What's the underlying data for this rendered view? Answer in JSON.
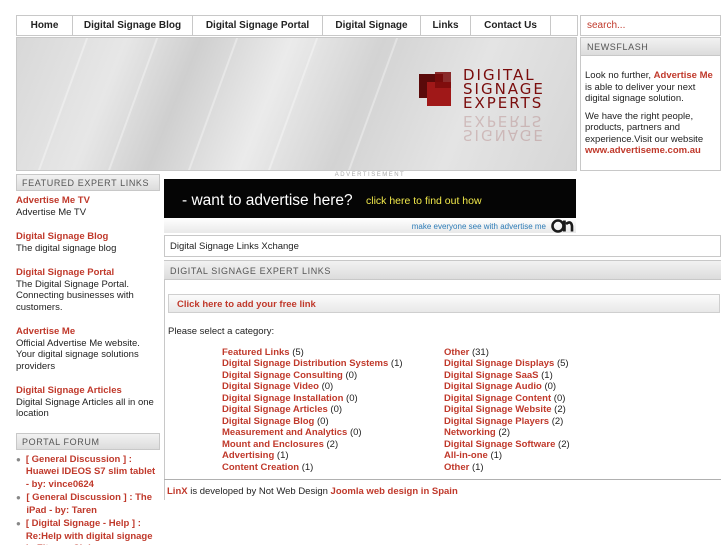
{
  "nav": {
    "items": [
      {
        "label": "Home"
      },
      {
        "label": "Digital Signage Blog"
      },
      {
        "label": "Digital Signage Portal"
      },
      {
        "label": "Digital Signage"
      },
      {
        "label": "Links"
      },
      {
        "label": "Contact Us"
      },
      {
        "label": ""
      }
    ]
  },
  "search": {
    "placeholder": "search..."
  },
  "banner": {
    "logo_lines": [
      "DIGITAL",
      "SIGNAGE",
      "EXPERTS"
    ],
    "logo_reflection": [
      "EXPERTS",
      "SIGNAGE"
    ]
  },
  "newsflash": {
    "header": "NEWSFLASH",
    "p1_prefix": "Look no further,",
    "p1_brand": "Advertise Me",
    "p1_suffix": "is able to deliver your next digital signage solution.",
    "p2": "We have the right people, products, partners and experience.Visit our website",
    "p2_link": "www.advertiseme.com.au"
  },
  "featured": {
    "header": "FEATURED EXPERT LINKS",
    "items": [
      {
        "title": "Advertise Me TV",
        "desc": "Advertise Me TV"
      },
      {
        "title": "Digital Signage Blog",
        "desc": "The digital signage blog"
      },
      {
        "title": "Digital Signage Portal",
        "desc": "The Digital Signage Portal. Connecting businesses with customers."
      },
      {
        "title": "Advertise Me",
        "desc": "Official Advertise Me website. Your digital signage solutions providers"
      },
      {
        "title": "Digital Signage Articles",
        "desc": "Digital Signage Articles all in one location"
      }
    ]
  },
  "forum": {
    "header": "PORTAL FORUM",
    "items": [
      {
        "text": "[ General Discussion ] : Huawei IDEOS S7 slim tablet - by: vince0624"
      },
      {
        "text": "[ General Discussion ] : The iPad - by: Taren"
      },
      {
        "text": "[ Digital Signage - Help ] : Re:Help with digital signage in Fitness Clubs"
      }
    ]
  },
  "ad": {
    "label": "ADVERTISEMENT",
    "main": "- want to advertise here?",
    "cta": "click here to find out how",
    "sub": "make everyone see with advertise me"
  },
  "xchange": {
    "title": "Digital Signage Links Xchange"
  },
  "links_panel": {
    "header": "DIGITAL SIGNAGE EXPERT LINKS",
    "add_link": "Click here to add your free link",
    "select_label": "Please select a category:",
    "categories_left": [
      {
        "name": "Featured Links",
        "count": "(5)"
      },
      {
        "name": "Digital Signage Distribution Systems",
        "count": "(1)"
      },
      {
        "name": "Digital Signage Consulting",
        "count": "(0)"
      },
      {
        "name": "Digital Signage Video",
        "count": "(0)"
      },
      {
        "name": "Digital Signage Installation",
        "count": "(0)"
      },
      {
        "name": "Digital Signage Articles",
        "count": "(0)"
      },
      {
        "name": "Digital Signage Blog",
        "count": "(0)"
      },
      {
        "name": "Measurement and Analytics",
        "count": "(0)"
      },
      {
        "name": "Mount and Enclosures",
        "count": "(2)"
      },
      {
        "name": "Advertising",
        "count": "(1)"
      },
      {
        "name": "Content Creation",
        "count": "(1)"
      }
    ],
    "categories_right": [
      {
        "name": "Other",
        "count": "(31)"
      },
      {
        "name": "Digital Signage Displays",
        "count": "(5)"
      },
      {
        "name": "Digital Signage SaaS",
        "count": "(1)"
      },
      {
        "name": "Digital Signage Audio",
        "count": "(0)"
      },
      {
        "name": "Digital Signage Content",
        "count": "(0)"
      },
      {
        "name": "Digital Signage Website",
        "count": "(2)"
      },
      {
        "name": "Digital Signage Players",
        "count": "(2)"
      },
      {
        "name": "Networking",
        "count": "(2)"
      },
      {
        "name": "Digital Signage Software",
        "count": "(2)"
      },
      {
        "name": "All-in-one",
        "count": "(1)"
      },
      {
        "name": "Other",
        "count": "(1)"
      }
    ]
  },
  "footer": {
    "linx": "LinX",
    "mid": "is developed by Not Web Design",
    "link": "Joomla web design in Spain"
  },
  "colors": {
    "accent": "#c0392b",
    "logo": "#7a0c0c",
    "ad_cta": "#f1e94a"
  }
}
